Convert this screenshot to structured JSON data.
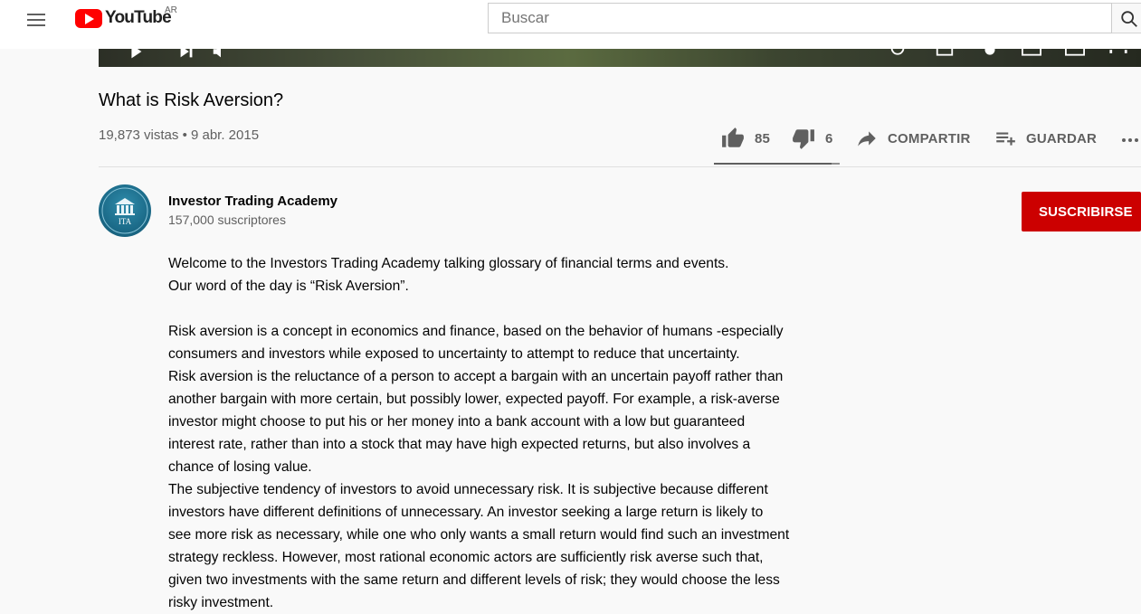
{
  "masthead": {
    "logo_text": "YouTube",
    "country_code": "AR",
    "search_placeholder": "Buscar"
  },
  "video": {
    "title": "What is Risk Aversion?",
    "views": "19,873 vistas",
    "date": "9 abr. 2015",
    "likes": "85",
    "dislikes": "6",
    "like_ratio": 0.934
  },
  "actions": {
    "share_label": "COMPARTIR",
    "save_label": "GUARDAR"
  },
  "channel": {
    "avatar_text": "ITA",
    "name": "Investor Trading Academy",
    "subscribers": "157,000 suscriptores",
    "subscribe_label": "SUSCRIBIRSE"
  },
  "description": [
    "Welcome to the Investors Trading Academy talking glossary of financial terms and events.",
    "Our word of the day is “Risk Aversion”.",
    "",
    "Risk aversion is a concept in economics and finance, based on the behavior of humans -especially",
    "consumers and investors while exposed to uncertainty to attempt to reduce that uncertainty.",
    "Risk aversion is the reluctance of a person to accept a bargain with an uncertain payoff rather than",
    "another bargain with more certain, but possibly lower, expected payoff. For example, a risk-averse",
    "investor might choose to put his or her money into a bank account with a low but guaranteed",
    "interest rate, rather than into a stock that may have high expected returns, but also involves a",
    "chance of losing value.",
    "The subjective tendency of investors to avoid unnecessary risk. It is subjective because different",
    "investors have different definitions of unnecessary. An investor seeking a large return is likely to",
    "see more risk as necessary, while one who only wants a small return would find such an investment",
    "strategy reckless. However, most rational economic actors are sufficiently risk averse such that,",
    "given two investments with the same return and different levels of risk; they would choose the less",
    "risky investment."
  ],
  "icons": {
    "menu": "hamburger-icon",
    "search": "search-icon",
    "like": "thumbs-up-icon",
    "dislike": "thumbs-down-icon",
    "share": "share-arrow-icon",
    "save": "playlist-add-icon",
    "more": "more-horizontal-icon"
  },
  "colors": {
    "brand_red": "#ff0000",
    "subscribe_red": "#cc0000",
    "secondary_text": "#606060"
  }
}
